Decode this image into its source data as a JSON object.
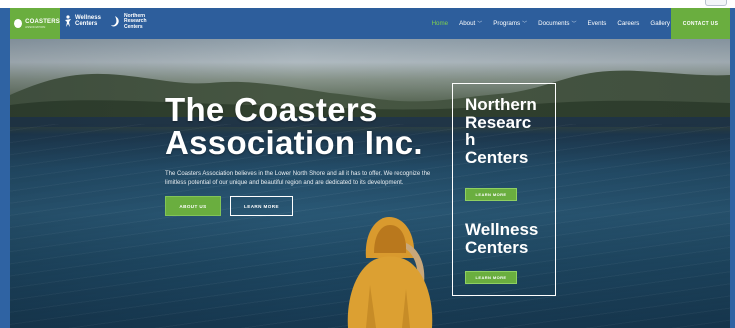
{
  "nav": {
    "logos": {
      "coasters_line1": "COASTERS",
      "coasters_line2": "ASSOCIATION",
      "wellness_line1": "Wellness",
      "wellness_line2": "Centers",
      "northern_line1": "Northern",
      "northern_line2": "Research",
      "northern_line3": "Centers"
    },
    "items": [
      {
        "label": "Home",
        "active": true,
        "dropdown": false
      },
      {
        "label": "About",
        "active": false,
        "dropdown": true
      },
      {
        "label": "Programs",
        "active": false,
        "dropdown": true
      },
      {
        "label": "Documents",
        "active": false,
        "dropdown": true
      },
      {
        "label": "Events",
        "active": false,
        "dropdown": false
      },
      {
        "label": "Careers",
        "active": false,
        "dropdown": false
      },
      {
        "label": "Gallery",
        "active": false,
        "dropdown": false
      }
    ],
    "contact_label": "CONTACT US"
  },
  "hero": {
    "title_line1": "The Coasters",
    "title_line2": "Association Inc.",
    "description": "The Coasters Association believes in the Lower North Shore and all it has to offer. We recognize the limitless potential of our unique and beautiful region and are dedicated to its development.",
    "about_button": "ABOUT US",
    "learn_button": "LEARN MORE"
  },
  "side_panel": {
    "northern_line1": "Northern",
    "northern_line2": "Researc",
    "northern_line3": "h",
    "northern_line4": "Centers",
    "northern_button": "LEARN MORE",
    "wellness_line1": "Wellness",
    "wellness_line2": "Centers",
    "wellness_button": "LEARN MORE"
  },
  "colors": {
    "nav_blue": "#2d5e9c",
    "accent_green": "#6aae3f",
    "active_link": "#7fd04e"
  },
  "icons": [
    "chevron-down-icon",
    "person-icon",
    "logo-circle-icon"
  ]
}
